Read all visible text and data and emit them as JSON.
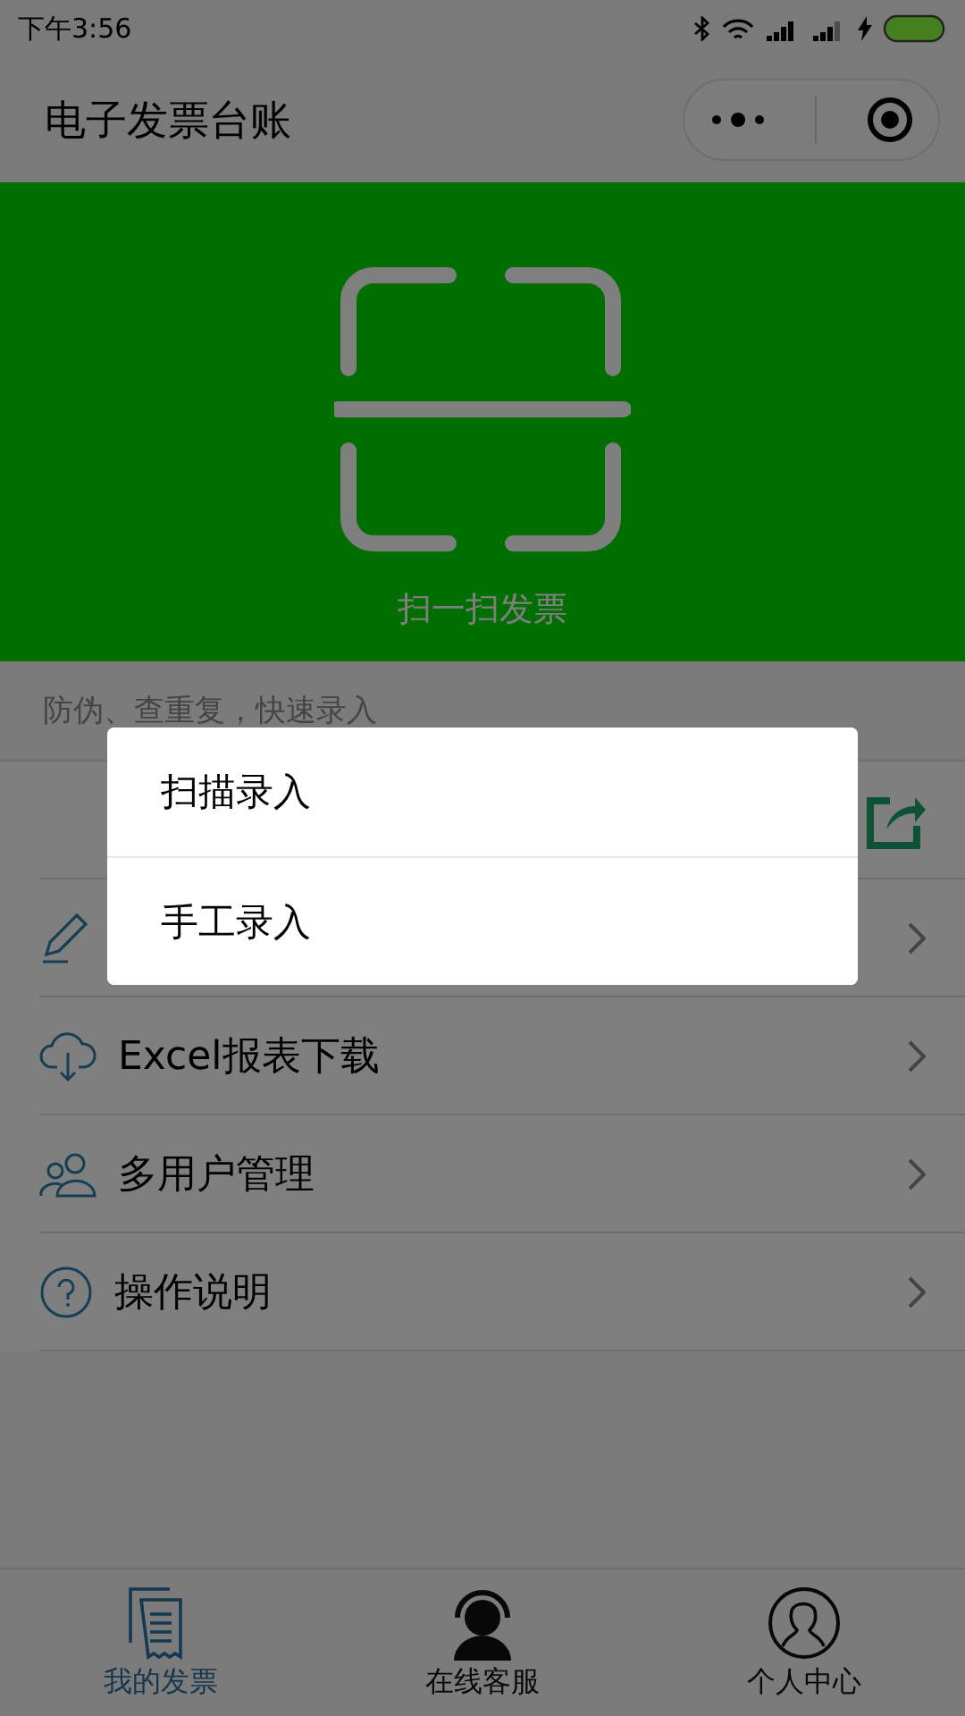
{
  "status_bar": {
    "time": "下午3:56"
  },
  "nav": {
    "title": "电子发票台账"
  },
  "banner": {
    "caption": "扫一扫发票"
  },
  "subtitle": "防伪、查重复，快速录入",
  "menu": [
    {
      "kind": "share"
    },
    {
      "kind": "edit"
    },
    {
      "kind": "download",
      "label": "Excel报表下载"
    },
    {
      "kind": "users",
      "label": "多用户管理"
    },
    {
      "kind": "help",
      "label": "操作说明"
    }
  ],
  "popup": {
    "options": [
      "扫描录入",
      "手工录入"
    ]
  },
  "tab_bar": [
    {
      "kind": "invoice",
      "label": "我的发票",
      "selected": true
    },
    {
      "kind": "service",
      "label": "在线客服",
      "selected": false
    },
    {
      "kind": "profile",
      "label": "个人中心",
      "selected": false
    }
  ]
}
